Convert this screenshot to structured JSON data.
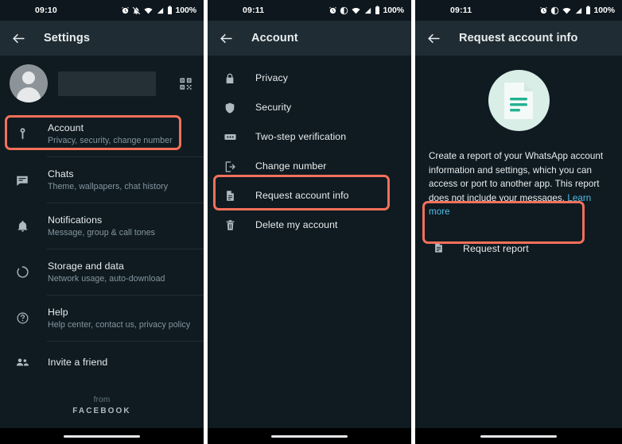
{
  "panels": [
    {
      "id": "settings",
      "status": {
        "time": "09:10",
        "battery": "100%",
        "icons": [
          "alarm-icon",
          "notifications-muted-icon",
          "wifi-icon",
          "signal-icon",
          "battery-icon"
        ]
      },
      "appbar": {
        "back": "back-arrow",
        "title": "Settings"
      },
      "profile": {
        "avatar": "user-avatar",
        "name": "",
        "qr": "qr-code-icon"
      },
      "items": [
        {
          "icon": "key-icon",
          "title": "Account",
          "sub": "Privacy, security, change number"
        },
        {
          "icon": "chat-icon",
          "title": "Chats",
          "sub": "Theme, wallpapers, chat history"
        },
        {
          "icon": "bell-icon",
          "title": "Notifications",
          "sub": "Message, group & call tones"
        },
        {
          "icon": "storage-icon",
          "title": "Storage and data",
          "sub": "Network usage, auto-download"
        },
        {
          "icon": "help-icon",
          "title": "Help",
          "sub": "Help center, contact us, privacy policy"
        }
      ],
      "invite": {
        "icon": "people-icon",
        "title": "Invite a friend"
      },
      "footer": {
        "from": "from",
        "brand": "FACEBOOK"
      },
      "highlight": "Account"
    },
    {
      "id": "account",
      "status": {
        "time": "09:11",
        "battery": "100%",
        "icons": [
          "alarm-icon",
          "dnd-icon",
          "wifi-icon",
          "signal-icon",
          "battery-icon"
        ]
      },
      "appbar": {
        "back": "back-arrow",
        "title": "Account"
      },
      "items": [
        {
          "icon": "lock-icon",
          "title": "Privacy"
        },
        {
          "icon": "shield-icon",
          "title": "Security"
        },
        {
          "icon": "dots-box-icon",
          "title": "Two-step verification"
        },
        {
          "icon": "exit-icon",
          "title": "Change number"
        },
        {
          "icon": "document-icon",
          "title": "Request account info"
        },
        {
          "icon": "trash-icon",
          "title": "Delete my account"
        }
      ],
      "highlight": "Request account info"
    },
    {
      "id": "request-account-info",
      "status": {
        "time": "09:11",
        "battery": "100%",
        "icons": [
          "alarm-icon",
          "dnd-icon",
          "wifi-icon",
          "signal-icon",
          "battery-icon"
        ]
      },
      "appbar": {
        "back": "back-arrow",
        "title": "Request account info"
      },
      "hero": "document-illustration",
      "body_text": "Create a report of your WhatsApp account information and settings, which you can access or port to another app. This report does not include your messages. ",
      "link_text": "Learn more",
      "action": {
        "icon": "document-icon",
        "label": "Request report"
      },
      "highlight": "Request report"
    }
  ],
  "colors": {
    "background": "#0f1b21",
    "appbar": "#1f2c33",
    "statusbar": "#0d171d",
    "highlight": "#f4705a",
    "primary_text": "#e9edef",
    "secondary_text": "#8696a0",
    "link": "#53bdeb",
    "hero_circle": "#d8eee6",
    "hero_accent": "#21b193",
    "navbar": "#000000"
  }
}
